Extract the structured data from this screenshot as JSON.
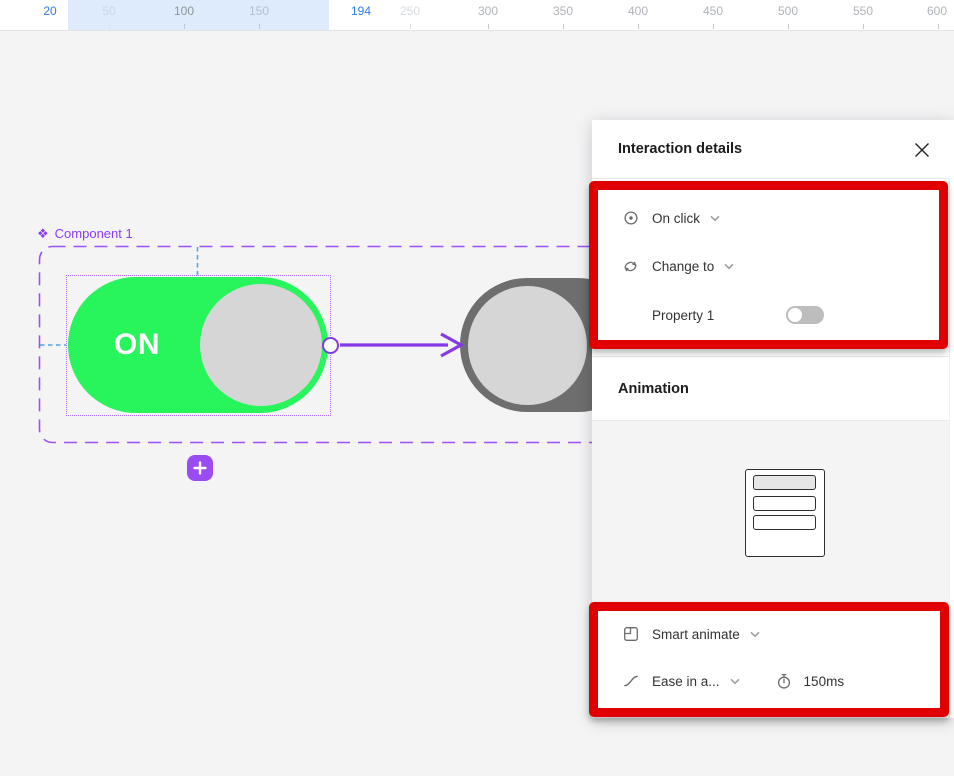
{
  "colors": {
    "toggle_on_green": "#27F55B",
    "toggle_off_gray": "#6E6E6E",
    "component_purple": "#8C3BF5",
    "prototype_arrow_purple": "#8638E8",
    "annotation_red": "#E00000",
    "ruler_selection_blue": "#2E7CEC",
    "ruler_selection_bg": "#DEEBFC"
  },
  "ruler": {
    "labels": [
      {
        "text": "20"
      },
      {
        "text": "50"
      },
      {
        "text": "100"
      },
      {
        "text": "150"
      },
      {
        "text": "194"
      },
      {
        "text": "250"
      },
      {
        "text": "300"
      },
      {
        "text": "350"
      },
      {
        "text": "400"
      },
      {
        "text": "450"
      },
      {
        "text": "500"
      },
      {
        "text": "550"
      },
      {
        "text": "600"
      }
    ]
  },
  "canvas": {
    "component_label": "Component 1",
    "component_icon_glyph": "❖",
    "toggle_on_text": "ON"
  },
  "panel": {
    "title": "Interaction details",
    "trigger_label": "On click",
    "action_label": "Change to",
    "property_label": "Property 1",
    "animation_section_title": "Animation",
    "animation_type": "Smart animate",
    "easing_label": "Ease in a...",
    "duration_label": "150ms"
  }
}
